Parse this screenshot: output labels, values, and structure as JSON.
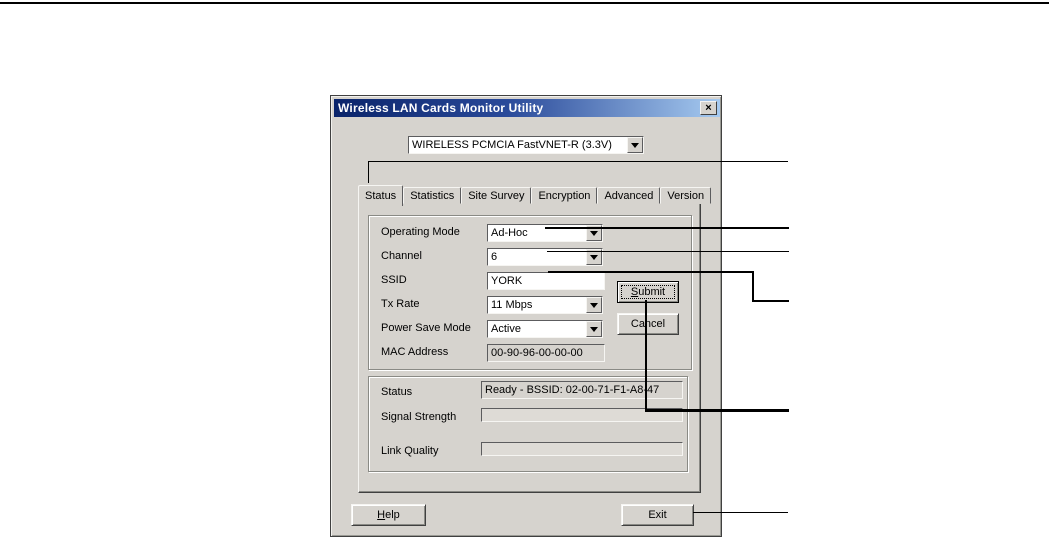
{
  "window": {
    "title": "Wireless LAN Cards Monitor Utility",
    "close_glyph": "×"
  },
  "device_selector": {
    "value": "WIRELESS PCMCIA FastVNET-R (3.3V)"
  },
  "tabs": [
    {
      "label": "Status"
    },
    {
      "label": "Statistics"
    },
    {
      "label": "Site Survey"
    },
    {
      "label": "Encryption"
    },
    {
      "label": "Advanced"
    },
    {
      "label": "Version"
    }
  ],
  "fields": [
    {
      "label": "Operating Mode",
      "value": "Ad-Hoc"
    },
    {
      "label": "Channel",
      "value": "6"
    },
    {
      "label": "SSID",
      "value": "YORK"
    },
    {
      "label": "Tx Rate",
      "value": "11 Mbps"
    },
    {
      "label": "Power Save Mode",
      "value": "Active"
    },
    {
      "label": "MAC Address",
      "value": "00-90-96-00-00-00"
    }
  ],
  "actions": {
    "submit": "Submit",
    "cancel": "Cancel"
  },
  "status_group": {
    "status_label": "Status",
    "status_value": "Ready - BSSID: 02-00-71-F1-A8-47",
    "signal_label": "Signal Strength",
    "link_label": "Link Quality"
  },
  "footer": {
    "help": "Help",
    "exit": "Exit"
  },
  "colors": {
    "face": "#d6d3ce",
    "title_gradient_start": "#0a246a",
    "title_gradient_end": "#a6caf0",
    "callout_line": "#000000"
  }
}
